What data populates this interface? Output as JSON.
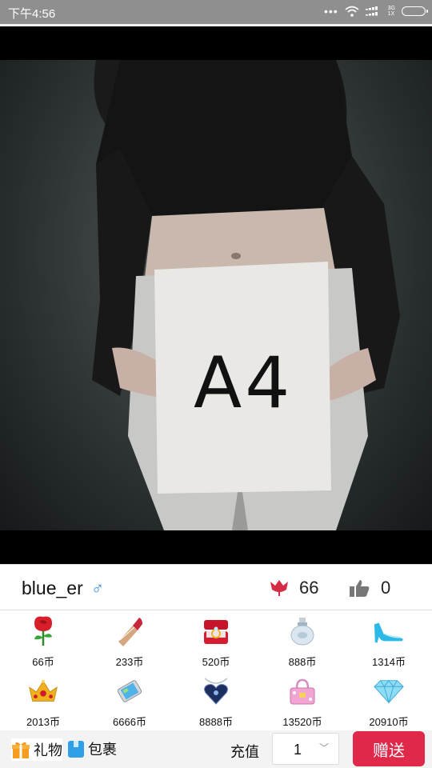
{
  "status": {
    "time": "下午4:56",
    "net_top": "3G",
    "net_bottom": "1X"
  },
  "photo": {
    "sign_text": "A4"
  },
  "profile": {
    "username": "blue_er",
    "gender_symbol": "♂",
    "flowers": "66",
    "likes": "0"
  },
  "gifts": [
    {
      "icon": "rose-icon",
      "price": "66币"
    },
    {
      "icon": "lipstick-icon",
      "price": "233币"
    },
    {
      "icon": "ring-box-icon",
      "price": "520币"
    },
    {
      "icon": "perfume-icon",
      "price": "888币"
    },
    {
      "icon": "high-heel-icon",
      "price": "1314币"
    },
    {
      "icon": "crown-icon",
      "price": "2013币"
    },
    {
      "icon": "phone-icon",
      "price": "6666币"
    },
    {
      "icon": "heart-necklace-icon",
      "price": "8888币"
    },
    {
      "icon": "handbag-icon",
      "price": "13520币"
    },
    {
      "icon": "diamond-icon",
      "price": "20910币"
    }
  ],
  "bottom": {
    "tab_gift": "礼物",
    "tab_package": "包裹",
    "recharge": "充值",
    "quantity": "1",
    "send": "赠送"
  },
  "colors": {
    "send_button": "#e0294a",
    "male": "#3b8fdb",
    "status_bar": "#8f8f8f"
  }
}
